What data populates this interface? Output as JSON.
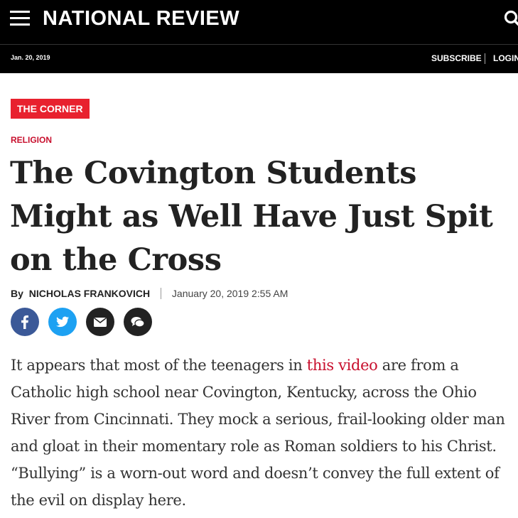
{
  "header": {
    "logo": "NATIONAL REVIEW",
    "date": "Jan. 20, 2019",
    "subscribe_label": "SUBSCRIBE",
    "login_label": "LOGIN"
  },
  "section_badge": "THE CORNER",
  "category": "RELIGION",
  "article": {
    "headline": "The Covington Students Might as Well Have Just Spit on the Cross",
    "byline_prefix": "By",
    "author": "NICHOLAS FRANKOVICH",
    "published": "January 20, 2019 2:55 AM",
    "body_before_link": "It appears that most of the teenagers in ",
    "body_link": "this video",
    "body_after_link": " are from a Catholic high school near Covington, Kentucky, across the Ohio River from Cincinnati. They mock a serious, frail-looking older man and gloat in their momentary role as Roman soldiers to his Christ. “Bullying” is a worn-out word and doesn’t convey the full extent of the evil on display here."
  },
  "share_buttons": [
    {
      "icon": "facebook-icon",
      "color": "#3b5998"
    },
    {
      "icon": "twitter-icon",
      "color": "#1da1f2"
    },
    {
      "icon": "email-icon",
      "color": "#222222"
    },
    {
      "icon": "comment-icon",
      "color": "#222222"
    }
  ],
  "colors": {
    "accent_red": "#e8212e",
    "link_red": "#c8102e",
    "header_bg": "#000000"
  }
}
